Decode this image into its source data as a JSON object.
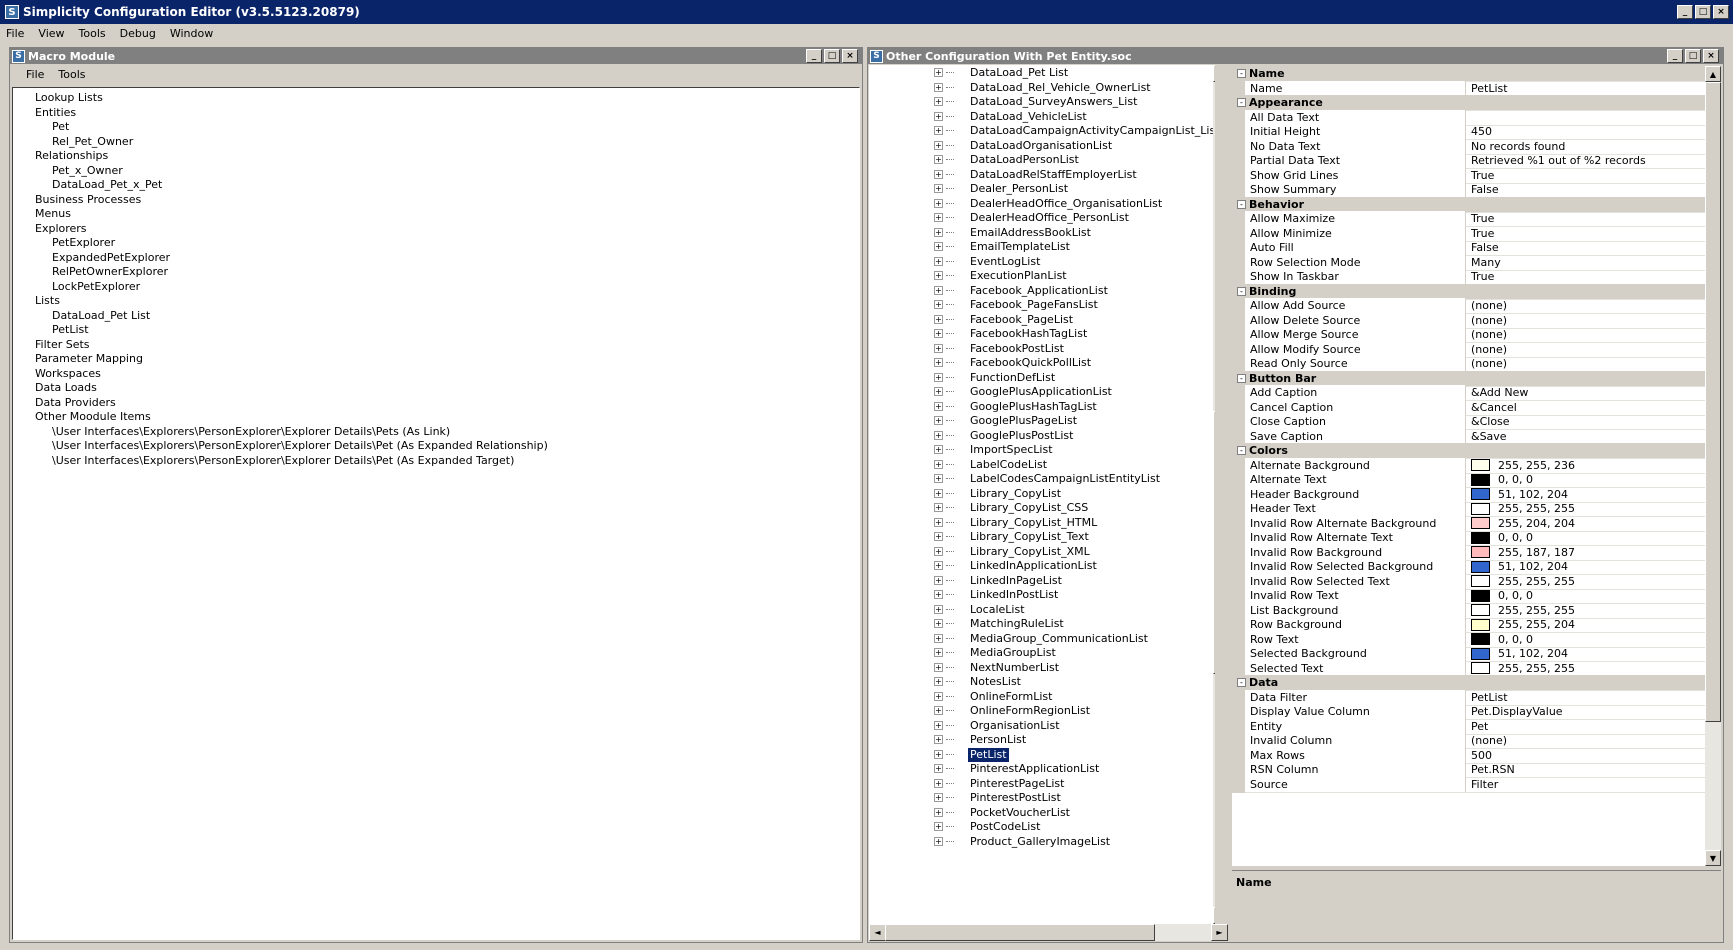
{
  "app": {
    "title": "Simplicity Configuration Editor (v3.5.5123.20879)",
    "menu": [
      "File",
      "View",
      "Tools",
      "Debug",
      "Window"
    ]
  },
  "macro": {
    "title": "Macro Module",
    "menu": [
      "File",
      "Tools"
    ],
    "tree": [
      {
        "label": "Lookup Lists",
        "level": 1
      },
      {
        "label": "Entities",
        "level": 1
      },
      {
        "label": "Pet",
        "level": 2
      },
      {
        "label": "Rel_Pet_Owner",
        "level": 2
      },
      {
        "label": "Relationships",
        "level": 1
      },
      {
        "label": "Pet_x_Owner",
        "level": 2
      },
      {
        "label": "DataLoad_Pet_x_Pet",
        "level": 2
      },
      {
        "label": "Business Processes",
        "level": 1
      },
      {
        "label": "Menus",
        "level": 1
      },
      {
        "label": "Explorers",
        "level": 1
      },
      {
        "label": "PetExplorer",
        "level": 2
      },
      {
        "label": "ExpandedPetExplorer",
        "level": 2
      },
      {
        "label": "RelPetOwnerExplorer",
        "level": 2
      },
      {
        "label": "LockPetExplorer",
        "level": 2
      },
      {
        "label": "Lists",
        "level": 1
      },
      {
        "label": "DataLoad_Pet List",
        "level": 2
      },
      {
        "label": "PetList",
        "level": 2
      },
      {
        "label": "Filter Sets",
        "level": 1
      },
      {
        "label": "Parameter Mapping",
        "level": 1
      },
      {
        "label": "Workspaces",
        "level": 1
      },
      {
        "label": "Data Loads",
        "level": 1
      },
      {
        "label": "Data Providers",
        "level": 1
      },
      {
        "label": "Other Moodule Items",
        "level": 1
      },
      {
        "label": "\\User Interfaces\\Explorers\\PersonExplorer\\Explorer Details\\Pets (As Link)",
        "level": 2
      },
      {
        "label": "\\User Interfaces\\Explorers\\PersonExplorer\\Explorer Details\\Pet (As Expanded Relationship)",
        "level": 2
      },
      {
        "label": "\\User Interfaces\\Explorers\\PersonExplorer\\Explorer Details\\Pet (As Expanded Target)",
        "level": 2
      }
    ]
  },
  "config": {
    "title": "Other Configuration With Pet Entity.soc",
    "list_items": [
      "DataLoad_Pet List",
      "DataLoad_Rel_Vehicle_OwnerList",
      "DataLoad_SurveyAnswers_List",
      "DataLoad_VehicleList",
      "DataLoadCampaignActivityCampaignList_List",
      "DataLoadOrganisationList",
      "DataLoadPersonList",
      "DataLoadRelStaffEmployerList",
      "Dealer_PersonList",
      "DealerHeadOffice_OrganisationList",
      "DealerHeadOffice_PersonList",
      "EmailAddressBookList",
      "EmailTemplateList",
      "EventLogList",
      "ExecutionPlanList",
      "Facebook_ApplicationList",
      "Facebook_PageFansList",
      "Facebook_PageList",
      "FacebookHashTagList",
      "FacebookPostList",
      "FacebookQuickPollList",
      "FunctionDefList",
      "GooglePlusApplicationList",
      "GooglePlusHashTagList",
      "GooglePlusPageList",
      "GooglePlusPostList",
      "ImportSpecList",
      "LabelCodeList",
      "LabelCodesCampaignListEntityList",
      "Library_CopyList",
      "Library_CopyList_CSS",
      "Library_CopyList_HTML",
      "Library_CopyList_Text",
      "Library_CopyList_XML",
      "LinkedInApplicationList",
      "LinkedInPageList",
      "LinkedInPostList",
      "LocaleList",
      "MatchingRuleList",
      "MediaGroup_CommunicationList",
      "MediaGroupList",
      "NextNumberList",
      "NotesList",
      "OnlineFormList",
      "OnlineFormRegionList",
      "OrganisationList",
      "PersonList",
      "PetList",
      "PinterestApplicationList",
      "PinterestPageList",
      "PinterestPostList",
      "PocketVoucherList",
      "PostCodeList",
      "Product_GalleryImageList"
    ],
    "selected_item": "PetList",
    "properties": [
      {
        "category": "Name"
      },
      {
        "name": "Name",
        "value": "PetList"
      },
      {
        "category": "Appearance"
      },
      {
        "name": "All Data Text",
        "value": ""
      },
      {
        "name": "Initial Height",
        "value": "450"
      },
      {
        "name": "No Data Text",
        "value": "No records found"
      },
      {
        "name": "Partial Data Text",
        "value": "Retrieved %1 out of %2 records"
      },
      {
        "name": "Show Grid Lines",
        "value": "True"
      },
      {
        "name": "Show Summary",
        "value": "False"
      },
      {
        "category": "Behavior"
      },
      {
        "name": "Allow Maximize",
        "value": "True"
      },
      {
        "name": "Allow Minimize",
        "value": "True"
      },
      {
        "name": "Auto Fill",
        "value": "False"
      },
      {
        "name": "Row Selection Mode",
        "value": "Many"
      },
      {
        "name": "Show In Taskbar",
        "value": "True"
      },
      {
        "category": "Binding"
      },
      {
        "name": "Allow Add Source",
        "value": "(none)"
      },
      {
        "name": "Allow Delete Source",
        "value": "(none)"
      },
      {
        "name": "Allow Merge Source",
        "value": "(none)"
      },
      {
        "name": "Allow Modify Source",
        "value": "(none)"
      },
      {
        "name": "Read Only Source",
        "value": "(none)"
      },
      {
        "category": "Button Bar"
      },
      {
        "name": "Add Caption",
        "value": "&Add New"
      },
      {
        "name": "Cancel Caption",
        "value": "&Cancel"
      },
      {
        "name": "Close Caption",
        "value": "&Close"
      },
      {
        "name": "Save Caption",
        "value": "&Save"
      },
      {
        "category": "Colors"
      },
      {
        "name": "Alternate Background",
        "value": "255, 255, 236",
        "color": "#ffffec"
      },
      {
        "name": "Alternate Text",
        "value": "0, 0, 0",
        "color": "#000000"
      },
      {
        "name": "Header Background",
        "value": "51, 102, 204",
        "color": "#3366cc"
      },
      {
        "name": "Header Text",
        "value": "255, 255, 255",
        "color": "#ffffff"
      },
      {
        "name": "Invalid Row Alternate Background",
        "value": "255, 204, 204",
        "color": "#ffcccc"
      },
      {
        "name": "Invalid Row Alternate Text",
        "value": "0, 0, 0",
        "color": "#000000"
      },
      {
        "name": "Invalid Row Background",
        "value": "255, 187, 187",
        "color": "#ffbbbb"
      },
      {
        "name": "Invalid Row Selected Background",
        "value": "51, 102, 204",
        "color": "#3366cc"
      },
      {
        "name": "Invalid Row Selected Text",
        "value": "255, 255, 255",
        "color": "#ffffff"
      },
      {
        "name": "Invalid Row Text",
        "value": "0, 0, 0",
        "color": "#000000"
      },
      {
        "name": "List Background",
        "value": "255, 255, 255",
        "color": "#ffffff"
      },
      {
        "name": "Row Background",
        "value": "255, 255, 204",
        "color": "#ffffcc"
      },
      {
        "name": "Row Text",
        "value": "0, 0, 0",
        "color": "#000000"
      },
      {
        "name": "Selected Background",
        "value": "51, 102, 204",
        "color": "#3366cc"
      },
      {
        "name": "Selected Text",
        "value": "255, 255, 255",
        "color": "#ffffff"
      },
      {
        "category": "Data"
      },
      {
        "name": "Data Filter",
        "value": "PetList"
      },
      {
        "name": "Display Value Column",
        "value": "Pet.DisplayValue"
      },
      {
        "name": "Entity",
        "value": "Pet"
      },
      {
        "name": "Invalid Column",
        "value": "(none)"
      },
      {
        "name": "Max Rows",
        "value": "500"
      },
      {
        "name": "RSN Column",
        "value": "Pet.RSN"
      },
      {
        "name": "Source",
        "value": "Filter"
      }
    ],
    "help_title": "Name"
  },
  "icons": {
    "app_logo": "S",
    "min": "_",
    "max": "□",
    "close": "×",
    "expand": "+",
    "collapse": "-",
    "up": "▲",
    "down": "▼",
    "left": "◄",
    "right": "►"
  }
}
